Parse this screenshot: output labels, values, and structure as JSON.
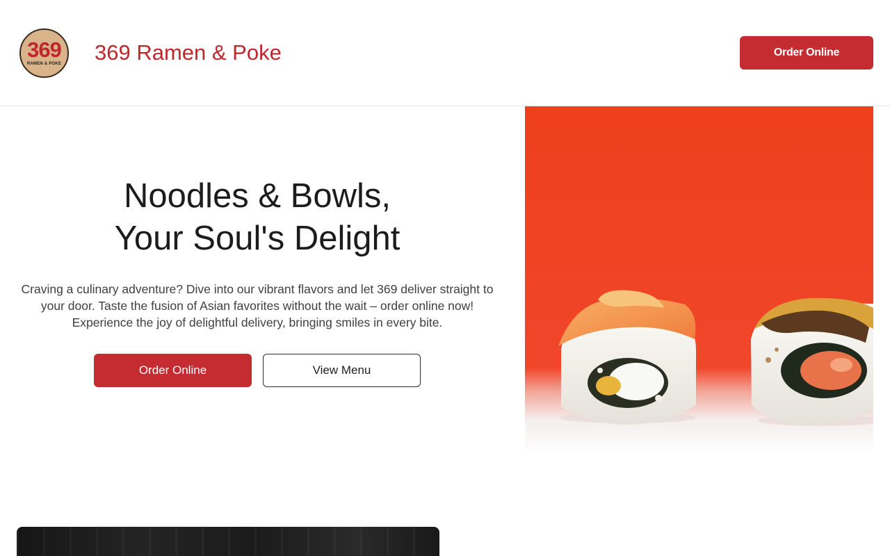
{
  "header": {
    "logo": {
      "number": "369",
      "subtitle": "RAMEN & POKE"
    },
    "brand_name": "369 Ramen & Poke",
    "cta_label": "Order Online"
  },
  "hero": {
    "title_line1": "Noodles & Bowls,",
    "title_line2": "Your Soul's Delight",
    "description": "Craving a culinary adventure? Dive into our vibrant flavors and let 369 deliver straight to your door. Taste the fusion of Asian favorites without the wait – order online now! Experience the joy of delightful delivery, bringing smiles in every bite.",
    "primary_button": "Order Online",
    "secondary_button": "View Menu",
    "image": "sushi-rolls-photo"
  },
  "colors": {
    "brand_red": "#c42c32",
    "brand_text_red": "#c0272d",
    "hero_image_bg": "#f0421e"
  }
}
